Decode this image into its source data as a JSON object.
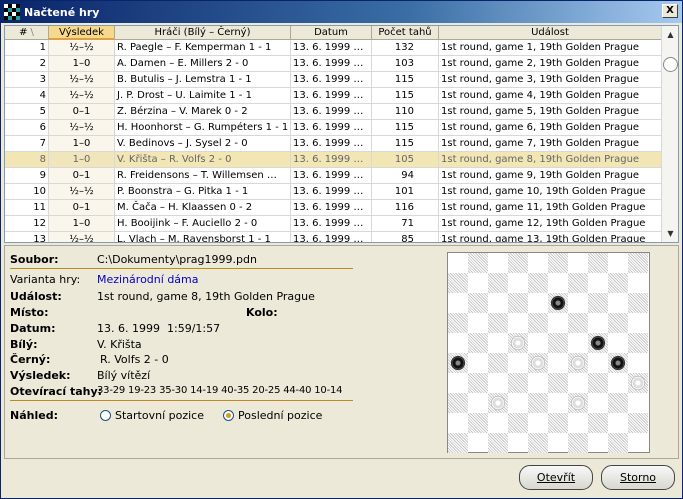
{
  "window": {
    "title": "Načtené hry",
    "close_label": "X"
  },
  "table": {
    "columns": [
      "#",
      "Výsledek",
      "Hráči (Bílý – Černý)",
      "Datum",
      "Počet tahů",
      "Událost"
    ],
    "sort_indicator": "\\",
    "selected_row": 8,
    "rows": [
      {
        "n": "1",
        "r": "½–½",
        "p": "R. Paegle – F. Kemperman  1 - 1",
        "d": "13. 6. 1999  …",
        "m": "132",
        "e": "1st round, game 1, 19th Golden Prague"
      },
      {
        "n": "2",
        "r": "1–0",
        "p": "A. Damen – E. Millers  2 - 0",
        "d": "13. 6. 1999  …",
        "m": "103",
        "e": "1st round, game 2, 19th Golden Prague"
      },
      {
        "n": "3",
        "r": "½–½",
        "p": "B. Butulis – J. Lemstra  1 - 1",
        "d": "13. 6. 1999  …",
        "m": "115",
        "e": "1st round, game 3, 19th Golden Prague"
      },
      {
        "n": "4",
        "r": "½–½",
        "p": "J. P. Drost – U. Laimite  1 - 1",
        "d": "13. 6. 1999  …",
        "m": "115",
        "e": "1st round, game 4, 19th Golden Prague"
      },
      {
        "n": "5",
        "r": "0–1",
        "p": "Z. Bérzina – V. Marek  0 - 2",
        "d": "13. 6. 1999  …",
        "m": "110",
        "e": "1st round, game 5, 19th Golden Prague"
      },
      {
        "n": "6",
        "r": "½–½",
        "p": "H. Hoonhorst – G. Rumpéters  1 - 1",
        "d": "13. 6. 1999  …",
        "m": "115",
        "e": "1st round, game 6, 19th Golden Prague"
      },
      {
        "n": "7",
        "r": "1–0",
        "p": "V. Bedinovs – J. Sysel  2 - 0",
        "d": "13. 6. 1999  …",
        "m": "115",
        "e": "1st round, game 7, 19th Golden Prague"
      },
      {
        "n": "8",
        "r": "1–0",
        "p": "V. Křišta – R. Volfs  2 - 0",
        "d": "13. 6. 1999  …",
        "m": "105",
        "e": "1st round, game 8, 19th Golden Prague"
      },
      {
        "n": "9",
        "r": "0–1",
        "p": "R. Freidensons – T. Willemsen  …",
        "d": "13. 6. 1999  …",
        "m": "94",
        "e": "1st round, game 9, 19th Golden Prague"
      },
      {
        "n": "10",
        "r": "½–½",
        "p": "P. Boonstra – G. Pitka  1 - 1",
        "d": "13. 6. 1999  …",
        "m": "101",
        "e": "1st round, game 10, 19th Golden Prague"
      },
      {
        "n": "11",
        "r": "0–1",
        "p": "M. Čača – H. Klaassen  0 - 2",
        "d": "13. 6. 1999  …",
        "m": "116",
        "e": "1st round, game 11, 19th Golden Prague"
      },
      {
        "n": "12",
        "r": "1–0",
        "p": "H. Booijink – F. Auciello  2 - 0",
        "d": "13. 6. 1999  …",
        "m": "71",
        "e": "1st round, game 12, 19th Golden Prague"
      },
      {
        "n": "13",
        "r": "½–½",
        "p": "L. Vlach – M. Ravensborst  1 - 1",
        "d": "13. 6. 1999  …",
        "m": "85",
        "e": "1st round, game 13, 19th Golden Prague"
      }
    ]
  },
  "details": {
    "soubor_label": "Soubor:",
    "soubor": "C:\\Dokumenty\\prag1999.pdn",
    "varianta_label": "Varianta hry:",
    "varianta": "Mezinárodní dáma",
    "udalost_label": "Událost:",
    "udalost": "1st round, game 8, 19th Golden Prague",
    "misto_label": "Místo:",
    "kolo_label": "Kolo:",
    "datum_label": "Datum:",
    "datum": "13. 6. 1999",
    "cas": "1:59/1:57",
    "bily_label": "Bílý:",
    "bily": "V. Křišta",
    "cerny_label": "Černý:",
    "cerny": "R. Volfs  2 - 0",
    "vysledek_label": "Výsledek:",
    "vysledek": "Bílý vítězí",
    "tahy_label": "Otevírací tahy:",
    "tahy": "33-29 19-23 35-30 14-19 40-35 20-25 44-40 10-14",
    "nahled_label": "Náhled:",
    "opt_start": "Startovní pozice",
    "opt_last": "Poslední pozice",
    "selected_option": "last"
  },
  "board": {
    "size": 10,
    "pieces": [
      {
        "row": 2,
        "col": 5,
        "color": "black"
      },
      {
        "row": 4,
        "col": 3,
        "color": "white"
      },
      {
        "row": 4,
        "col": 7,
        "color": "black"
      },
      {
        "row": 5,
        "col": 0,
        "color": "black"
      },
      {
        "row": 5,
        "col": 4,
        "color": "white"
      },
      {
        "row": 5,
        "col": 6,
        "color": "white"
      },
      {
        "row": 5,
        "col": 8,
        "color": "black"
      },
      {
        "row": 6,
        "col": 9,
        "color": "white"
      },
      {
        "row": 7,
        "col": 2,
        "color": "white"
      },
      {
        "row": 7,
        "col": 6,
        "color": "white"
      }
    ]
  },
  "buttons": {
    "open": "Otevřít",
    "cancel": "Storno"
  },
  "colors": {
    "selection": "#f2e6b4",
    "accent": "#c08a20",
    "link": "#0000c0"
  }
}
